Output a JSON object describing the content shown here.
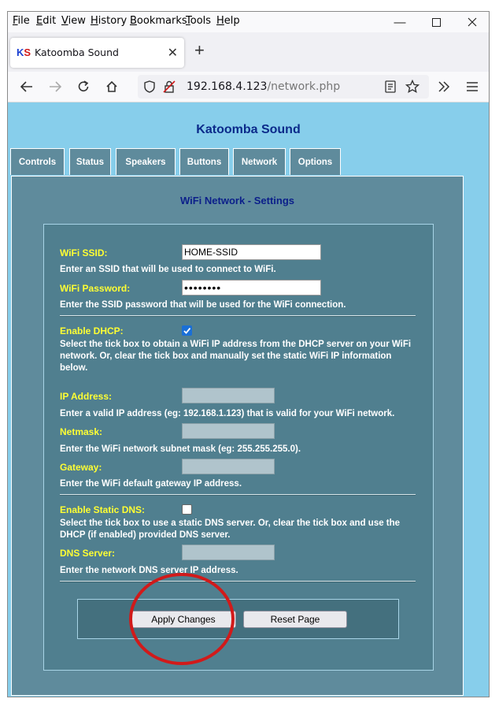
{
  "menubar": {
    "items": [
      {
        "label": "File",
        "u": "F",
        "rest": "ile"
      },
      {
        "label": "Edit",
        "u": "E",
        "rest": "dit"
      },
      {
        "label": "View",
        "u": "V",
        "rest": "iew"
      },
      {
        "label": "History",
        "u": "H",
        "rest": "istory"
      },
      {
        "label": "Bookmarks",
        "u": "B",
        "rest": "ookmarks"
      },
      {
        "label": "Tools",
        "u": "T",
        "rest": "ools"
      },
      {
        "label": "Help",
        "u": "H",
        "rest": "elp"
      }
    ]
  },
  "browser": {
    "tab_title": "Katoomba Sound",
    "favicon_text": "KS",
    "url_host": "192.168.4.123",
    "url_path": "/network.php"
  },
  "site": {
    "title": "Katoomba Sound",
    "nav_tabs": [
      "Controls",
      "Status",
      "Speakers",
      "Buttons",
      "Network",
      "Options"
    ],
    "active_tab": "Network"
  },
  "settings": {
    "title": "WiFi Network - Settings",
    "ssid": {
      "label": "WiFi SSID:",
      "value": "HOME-SSID",
      "desc": "Enter an SSID that will be used to connect to WiFi."
    },
    "password": {
      "label": "WiFi Password:",
      "value": "••••••••",
      "desc": "Enter the SSID password that will be used for the WiFi connection."
    },
    "dhcp": {
      "label": "Enable DHCP:",
      "checked": true,
      "desc": "Select the tick box to obtain a WiFi IP address from the DHCP server on your WiFi network. Or, clear the tick box and manually set the static WiFi IP information below."
    },
    "ip": {
      "label": "IP Address:",
      "value": "",
      "desc": "Enter a valid IP address (eg: 192.168.1.123) that is valid for your WiFi network."
    },
    "netmask": {
      "label": "Netmask:",
      "value": "",
      "desc": "Enter the WiFi network subnet mask (eg: 255.255.255.0)."
    },
    "gateway": {
      "label": "Gateway:",
      "value": "",
      "desc": "Enter the WiFi default gateway IP address."
    },
    "static_dns": {
      "label": "Enable Static DNS:",
      "checked": false,
      "desc": "Select the tick box to use a static DNS server. Or, clear the tick box and use the DHCP (if enabled) provided DNS server."
    },
    "dns": {
      "label": "DNS Server:",
      "value": "",
      "desc": "Enter the network DNS server IP address."
    },
    "apply_label": "Apply Changes",
    "reset_label": "Reset Page"
  },
  "colors": {
    "page_bg": "#87ceeb",
    "panel_bg": "#5f8b9c",
    "label_yellow": "#ffff33",
    "title_blue": "#0b2a8a",
    "annotation_red": "#d11a1a"
  }
}
